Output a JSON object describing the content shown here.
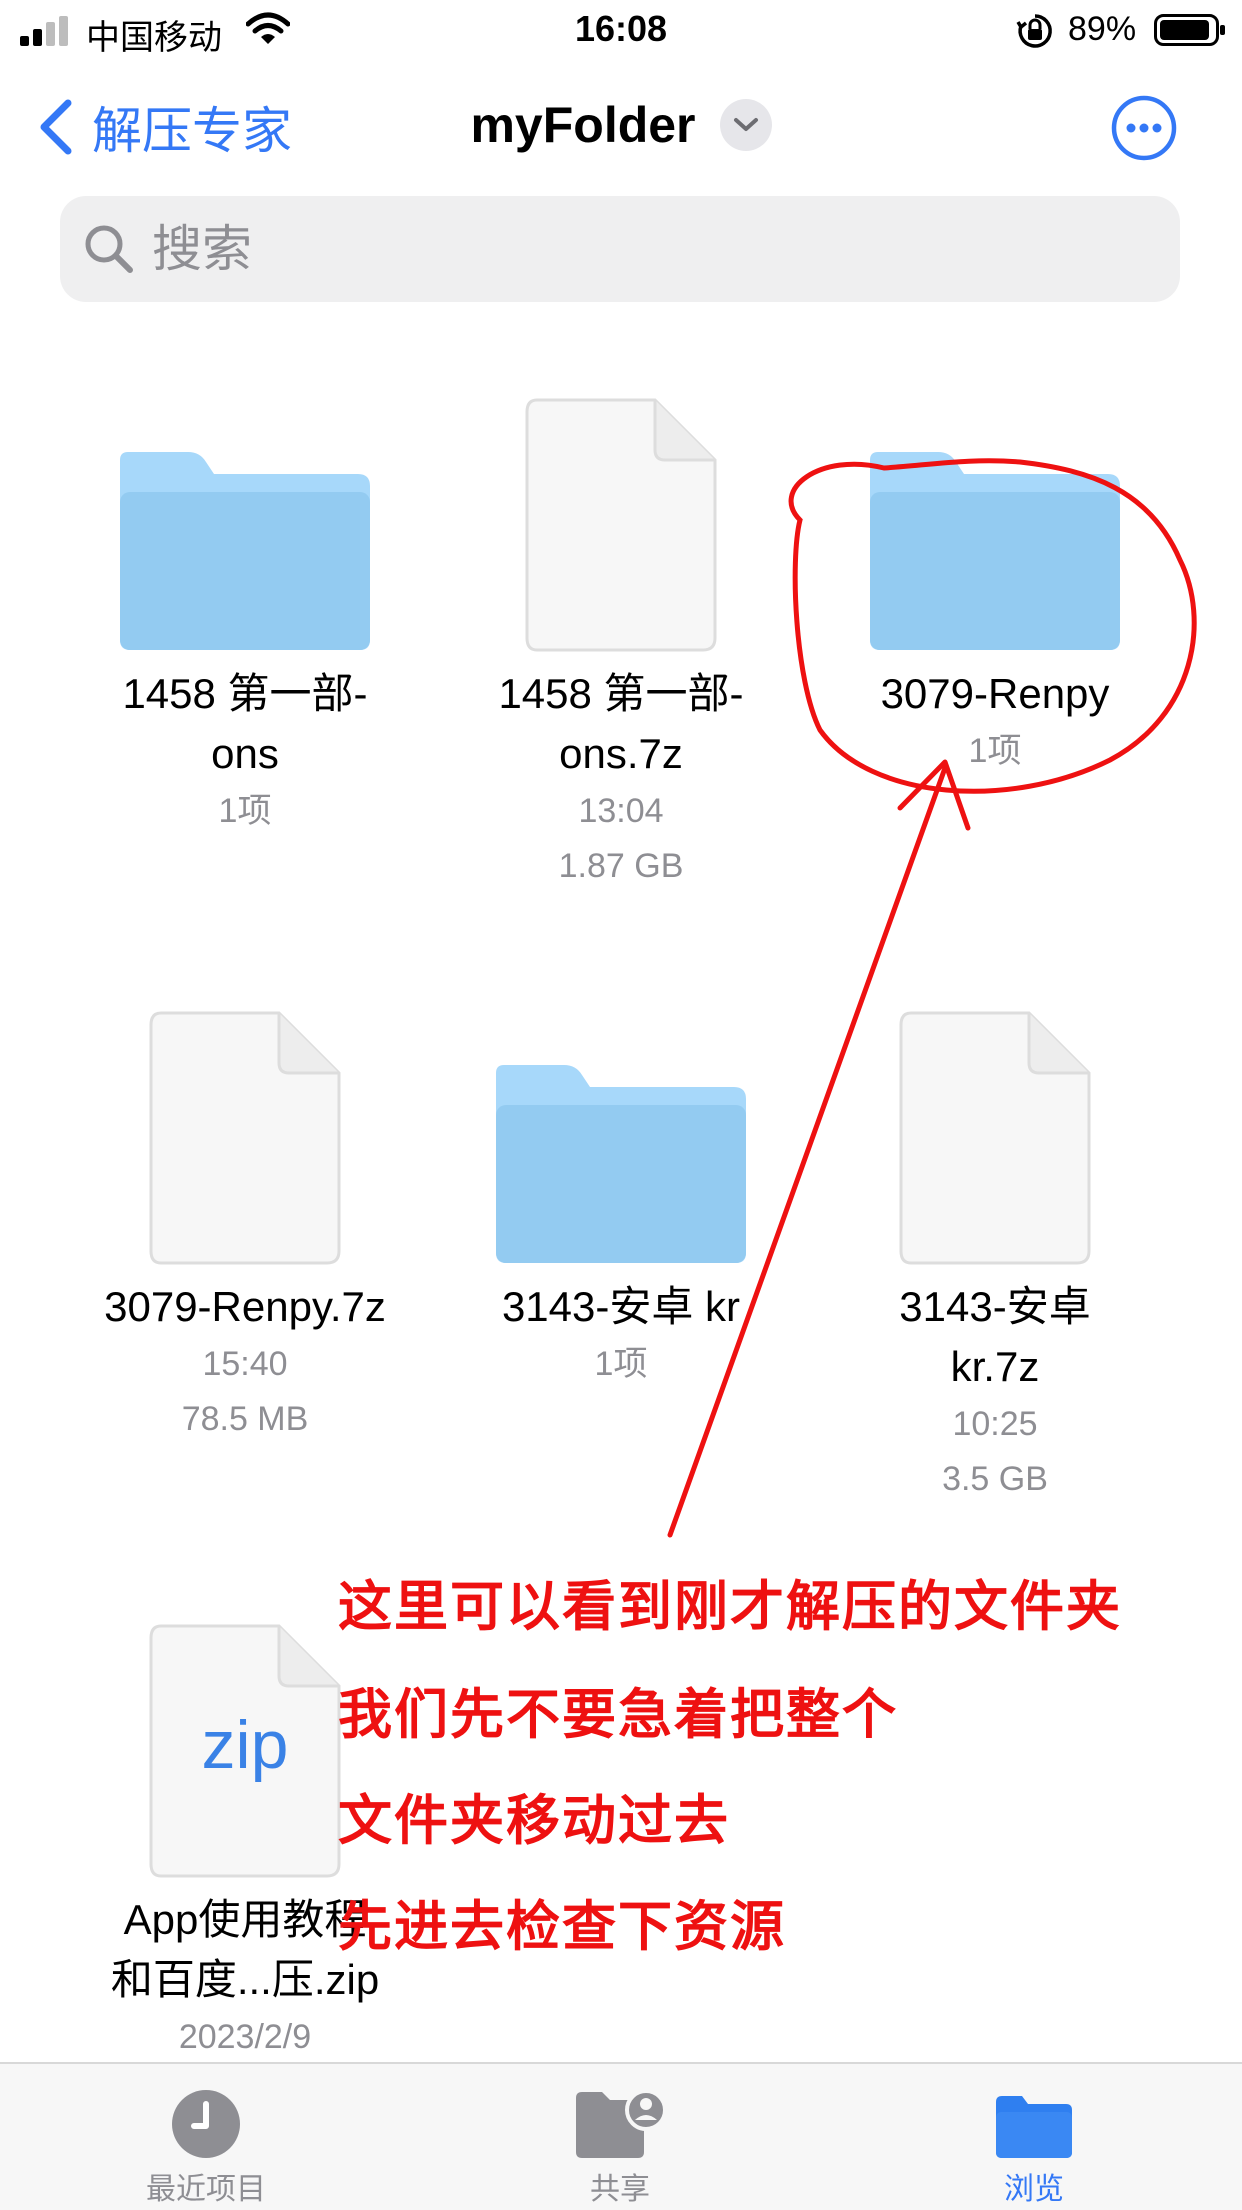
{
  "status_bar": {
    "carrier": "中国移动",
    "time": "16:08",
    "battery": "89%"
  },
  "nav": {
    "back_label": "解压专家",
    "title": "myFolder"
  },
  "search": {
    "placeholder": "搜索"
  },
  "items": [
    {
      "name_line1": "1458 第一部-",
      "name_line2": "ons",
      "meta1": "1项",
      "meta2": "",
      "kind": "folder-icon"
    },
    {
      "name_line1": "1458 第一部-",
      "name_line2": "ons.7z",
      "meta1": "13:04",
      "meta2": "1.87 GB",
      "kind": "document-icon"
    },
    {
      "name_line1": "3079-Renpy",
      "name_line2": "",
      "meta1": "1项",
      "meta2": "",
      "kind": "folder-icon"
    },
    {
      "name_line1": "3079-Renpy.7z",
      "name_line2": "",
      "meta1": "15:40",
      "meta2": "78.5 MB",
      "kind": "document-icon"
    },
    {
      "name_line1": "3143-安卓 kr",
      "name_line2": "",
      "meta1": "1项",
      "meta2": "",
      "kind": "folder-icon"
    },
    {
      "name_line1": "3143-安卓",
      "name_line2": "kr.7z",
      "meta1": "10:25",
      "meta2": "3.5 GB",
      "kind": "document-icon"
    },
    {
      "name_line1": "App使用教程",
      "name_line2": "和百度...压.zip",
      "meta1": "2023/2/9",
      "meta2": "",
      "kind": "zip-document-icon",
      "badge": "zip"
    }
  ],
  "annotation": {
    "lines": [
      "这里可以看到刚才解压的文件夹",
      "我们先不要急着把整个",
      "文件夹移动过去",
      "先进去检查下资源"
    ],
    "color": "#ee1111"
  },
  "tabs": [
    {
      "label": "最近项目",
      "icon": "clock-icon",
      "active": false
    },
    {
      "label": "共享",
      "icon": "shared-folder-icon",
      "active": false
    },
    {
      "label": "浏览",
      "icon": "folder-icon",
      "active": true
    }
  ],
  "colors": {
    "accent": "#3478f6",
    "folder": "#9fd2f7",
    "inactive_tab": "#8e8e93"
  }
}
